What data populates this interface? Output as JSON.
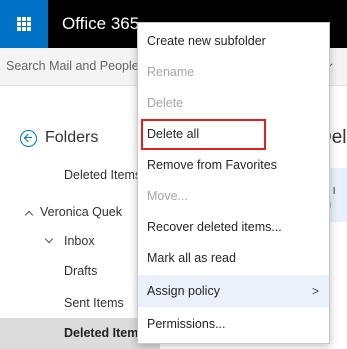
{
  "app": {
    "title": "Office 365"
  },
  "search": {
    "placeholder": "Search Mail and People"
  },
  "folders": {
    "heading": "Folders",
    "favorite_deleted": "Deleted Items",
    "account": "Veronica Quek",
    "inbox": "Inbox",
    "drafts": "Drafts",
    "sent": "Sent Items",
    "deleted": "Deleted Items"
  },
  "reading_pane": {
    "title": "Deleted Items",
    "line1": "A",
    "line2": "w: I",
    "line3": "ou"
  },
  "menu": {
    "items": [
      {
        "label": "Create new subfolder",
        "disabled": false
      },
      {
        "label": "Rename",
        "disabled": true
      },
      {
        "label": "Delete",
        "disabled": true
      },
      {
        "label": "Delete all",
        "disabled": false,
        "highlighted": true
      },
      {
        "label": "Remove from Favorites",
        "disabled": false
      },
      {
        "label": "Move...",
        "disabled": true
      },
      {
        "label": "Recover deleted items...",
        "disabled": false
      },
      {
        "label": "Mark all as read",
        "disabled": false
      },
      {
        "label": "Assign policy",
        "disabled": false,
        "submenu": true,
        "hover": true,
        "arrow": ">"
      },
      {
        "label": "Permissions...",
        "disabled": false
      }
    ]
  },
  "colors": {
    "brand": "#0072c6",
    "highlight": "#e02020",
    "topbar": "#000000"
  }
}
